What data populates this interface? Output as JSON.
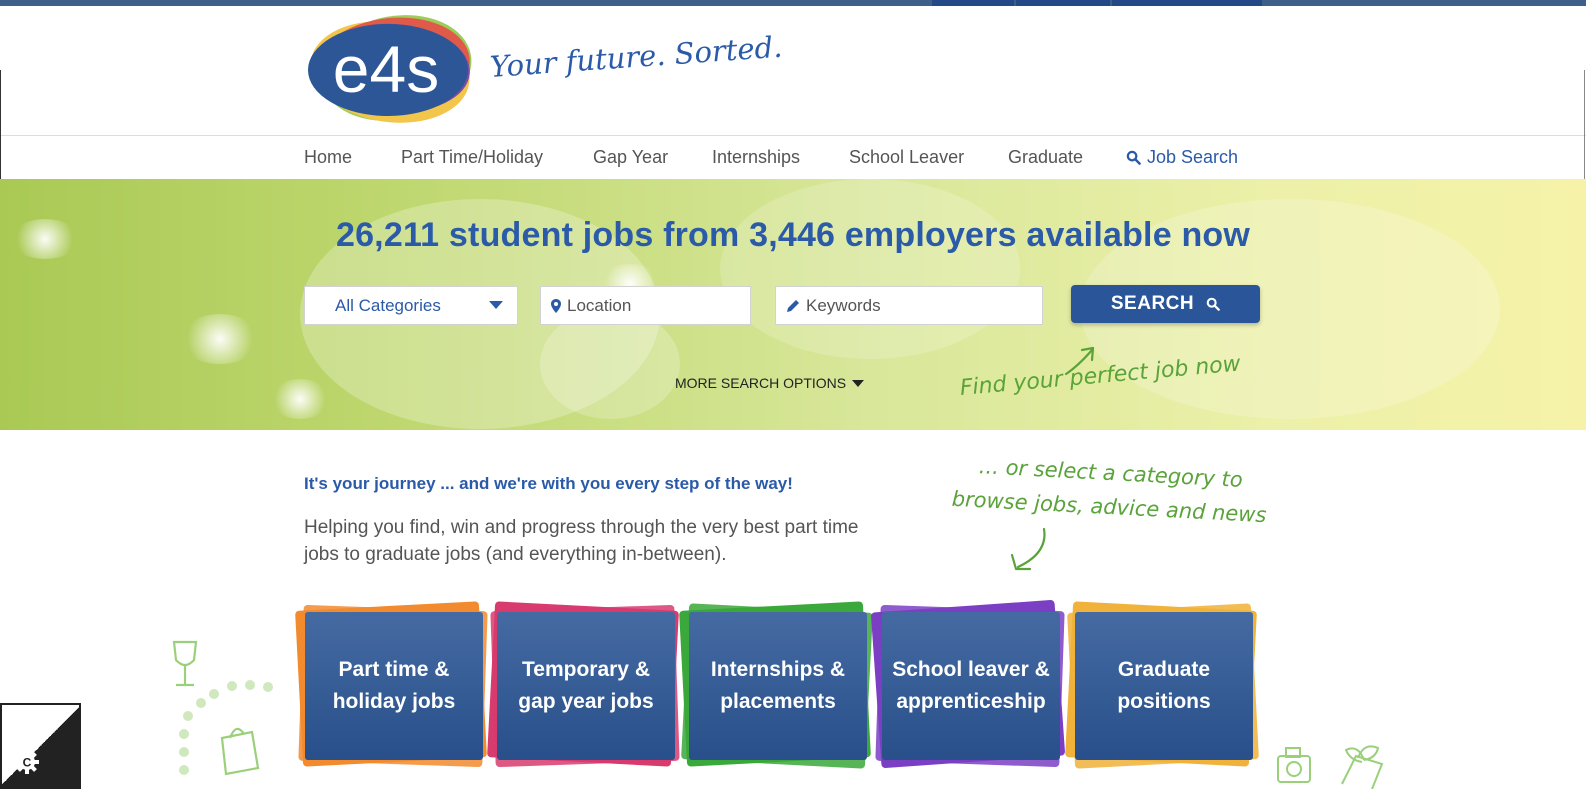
{
  "brand": {
    "logo_text": "e4s",
    "tagline": "Your future. Sorted."
  },
  "nav": {
    "items": [
      {
        "label": "Home"
      },
      {
        "label": "Part Time/Holiday"
      },
      {
        "label": "Gap Year"
      },
      {
        "label": "Internships"
      },
      {
        "label": "School Leaver"
      },
      {
        "label": "Graduate"
      }
    ],
    "job_search": {
      "label": "Job Search",
      "icon": "search-icon"
    }
  },
  "hero": {
    "title": "26,211 student jobs from 3,446 employers available now",
    "category_select": {
      "value": "All Categories",
      "icon": "caret-down-icon"
    },
    "location": {
      "placeholder": "Location",
      "icon": "map-marker-icon"
    },
    "keywords": {
      "placeholder": "Keywords",
      "icon": "pencil-icon"
    },
    "search_button": {
      "label": "SEARCH",
      "icon": "search-icon"
    },
    "more_options": "MORE SEARCH OPTIONS",
    "note": "Find your perfect job now"
  },
  "intro": {
    "title": "It's your journey ... and we're with you every step of the way!",
    "body": "Helping you find, win and progress through the very best part time jobs to graduate jobs (and everything in-between).",
    "category_note": "... or select a category to browse jobs, advice and news"
  },
  "categories": [
    {
      "line1": "Part time &",
      "line2": "holiday jobs",
      "accent": "#f28a2e"
    },
    {
      "line1": "Temporary &",
      "line2": "gap year jobs",
      "accent": "#d83b6e"
    },
    {
      "line1": "Internships &",
      "line2": "placements",
      "accent": "#3aa83a"
    },
    {
      "line1": "School leaver &",
      "line2": "apprenticeship",
      "accent": "#7b3fc4"
    },
    {
      "line1": "Graduate",
      "line2": "positions",
      "accent": "#f0b23a"
    }
  ],
  "colors": {
    "brand_blue": "#2a5699",
    "accent_green": "#5aa33a"
  }
}
